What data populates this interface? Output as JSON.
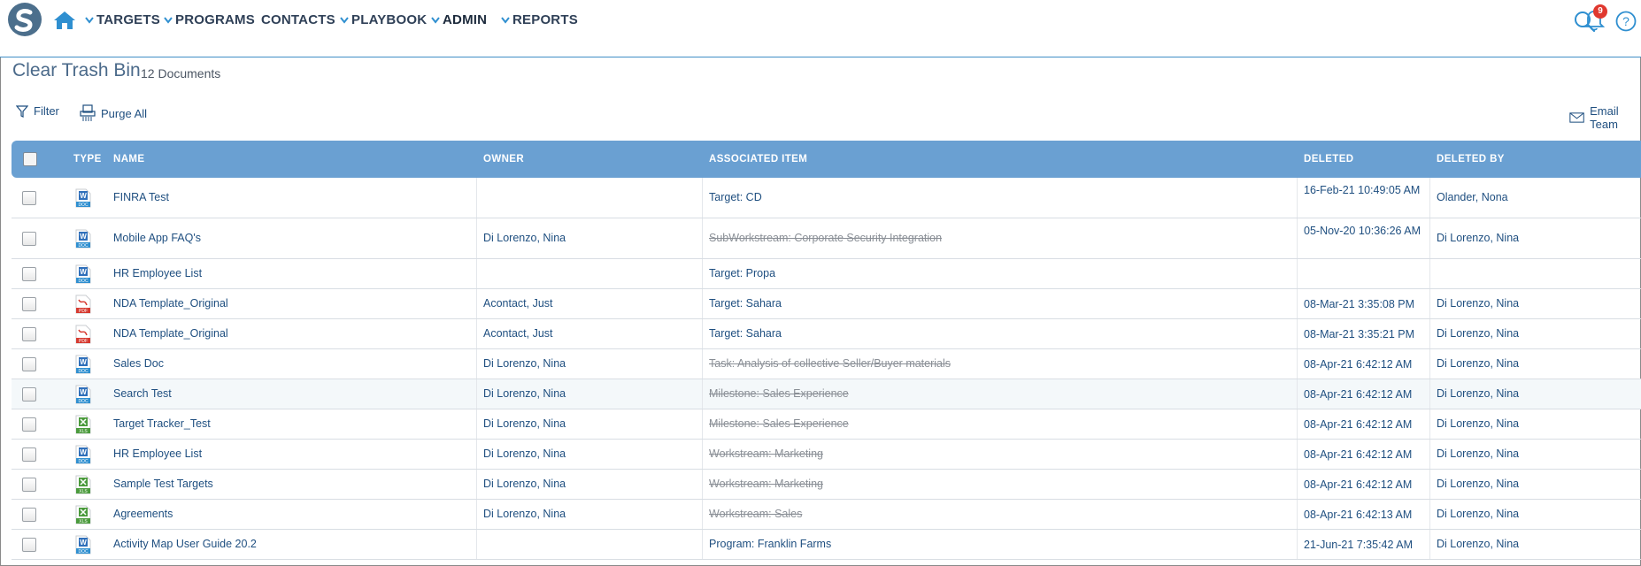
{
  "nav": {
    "items": [
      {
        "label": "TARGETS",
        "has_chevron": true
      },
      {
        "label": "PROGRAMS",
        "has_chevron": true
      },
      {
        "label": "CONTACTS",
        "has_chevron": false
      },
      {
        "label": "PLAYBOOK",
        "has_chevron": true
      },
      {
        "label": "ADMIN",
        "has_chevron": true
      },
      {
        "label": "REPORTS",
        "has_chevron": true
      }
    ],
    "notification_count": "9"
  },
  "page": {
    "title": "Clear Trash Bin",
    "document_count": "12 Documents"
  },
  "toolbar": {
    "filter_label": "Filter",
    "purge_label": "Purge All",
    "email_label": "Email Team"
  },
  "table": {
    "headers": {
      "type": "TYPE",
      "name": "NAME",
      "owner": "OWNER",
      "associated": "ASSOCIATED ITEM",
      "deleted": "DELETED",
      "deleted_by": "DELETED BY"
    },
    "rows": [
      {
        "type": "doc",
        "name": "FINRA Test",
        "owner": "",
        "associated": "Target: CD",
        "associated_struck": false,
        "deleted": "16-Feb-21 10:49:05 AM",
        "deleted_by": "Olander, Nona"
      },
      {
        "type": "doc",
        "name": "Mobile App FAQ's",
        "owner": "Di Lorenzo, Nina",
        "associated": "SubWorkstream: Corporate Security Integration",
        "associated_struck": true,
        "deleted": "05-Nov-20 10:36:26 AM",
        "deleted_by": "Di Lorenzo, Nina"
      },
      {
        "type": "doc",
        "name": "HR Employee List",
        "owner": "",
        "associated": "Target: Propa",
        "associated_struck": false,
        "deleted": "",
        "deleted_by": ""
      },
      {
        "type": "pdf",
        "name": "NDA Template_Original",
        "owner": "Acontact, Just",
        "associated": "Target: Sahara",
        "associated_struck": false,
        "deleted": "08-Mar-21 3:35:08 PM",
        "deleted_by": "Di Lorenzo, Nina"
      },
      {
        "type": "pdf",
        "name": "NDA Template_Original",
        "owner": "Acontact, Just",
        "associated": "Target: Sahara",
        "associated_struck": false,
        "deleted": "08-Mar-21 3:35:21 PM",
        "deleted_by": "Di Lorenzo, Nina"
      },
      {
        "type": "doc",
        "name": "Sales Doc",
        "owner": "Di Lorenzo, Nina",
        "associated": "Task: Analysis of collective Seller/Buyer materials",
        "associated_struck": true,
        "deleted": "08-Apr-21 6:42:12 AM",
        "deleted_by": "Di Lorenzo, Nina"
      },
      {
        "type": "doc",
        "name": "Search Test",
        "owner": "Di Lorenzo, Nina",
        "associated": "Milestone: Sales Experience",
        "associated_struck": true,
        "deleted": "08-Apr-21 6:42:12 AM",
        "deleted_by": "Di Lorenzo, Nina"
      },
      {
        "type": "xls",
        "name": "Target Tracker_Test",
        "owner": "Di Lorenzo, Nina",
        "associated": "Milestone: Sales Experience",
        "associated_struck": true,
        "deleted": "08-Apr-21 6:42:12 AM",
        "deleted_by": "Di Lorenzo, Nina"
      },
      {
        "type": "doc",
        "name": "HR Employee List",
        "owner": "Di Lorenzo, Nina",
        "associated": "Workstream: Marketing",
        "associated_struck": true,
        "deleted": "08-Apr-21 6:42:12 AM",
        "deleted_by": "Di Lorenzo, Nina"
      },
      {
        "type": "xls",
        "name": "Sample Test Targets",
        "owner": "Di Lorenzo, Nina",
        "associated": "Workstream: Marketing",
        "associated_struck": true,
        "deleted": "08-Apr-21 6:42:12 AM",
        "deleted_by": "Di Lorenzo, Nina"
      },
      {
        "type": "xls",
        "name": "Agreements",
        "owner": "Di Lorenzo, Nina",
        "associated": "Workstream: Sales",
        "associated_struck": true,
        "deleted": "08-Apr-21 6:42:13 AM",
        "deleted_by": "Di Lorenzo, Nina"
      },
      {
        "type": "doc",
        "name": "Activity Map User Guide 20.2",
        "owner": "",
        "associated": "Program: Franklin Farms",
        "associated_struck": false,
        "deleted": "21-Jun-21 7:35:42 AM",
        "deleted_by": "Di Lorenzo, Nina"
      }
    ]
  },
  "colors": {
    "header_bg": "#6aa0d2",
    "link": "#1f4f80",
    "accent": "#2f8fd0",
    "badge": "#e0382f"
  }
}
